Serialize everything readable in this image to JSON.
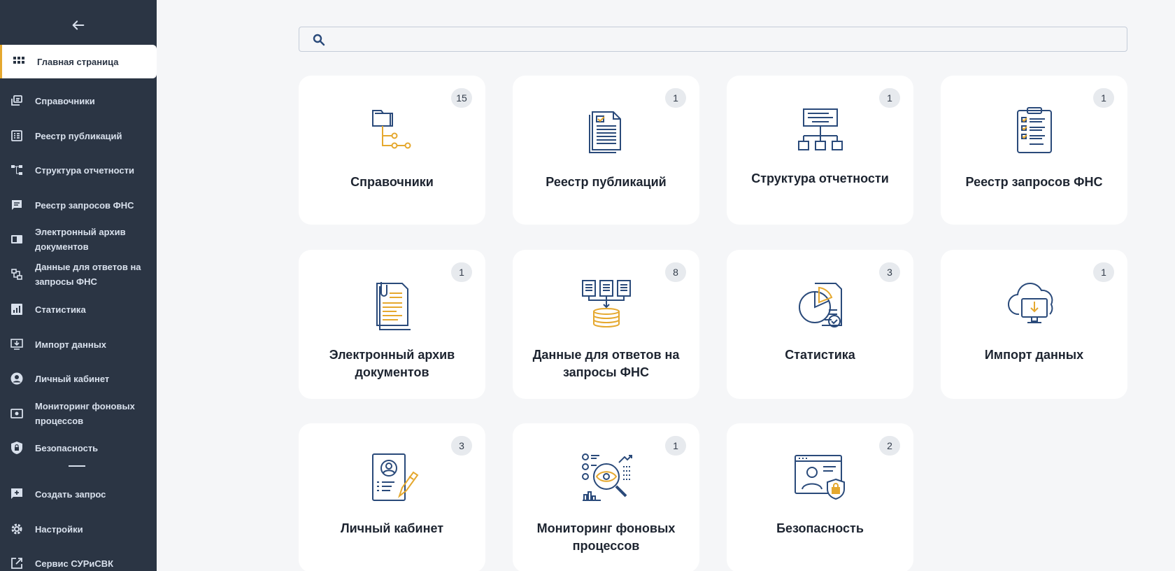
{
  "sidebar": {
    "active": {
      "label": "Главная страница",
      "icon": "grid-icon"
    },
    "items": [
      {
        "label": "Справочники",
        "icon": "copy-icon"
      },
      {
        "label": "Реестр публикаций",
        "icon": "list-icon"
      },
      {
        "label": "Структура отчетности",
        "icon": "hierarchy-icon"
      },
      {
        "label": "Реестр запросов ФНС",
        "icon": "chat-lines-icon"
      },
      {
        "label": "Электронный архив документов",
        "icon": "archive-icon"
      },
      {
        "label": "Данные для ответов на запросы ФНС",
        "icon": "data-flow-icon"
      },
      {
        "label": "Статистика",
        "icon": "bar-chart-icon"
      },
      {
        "label": "Импорт данных",
        "icon": "import-icon"
      },
      {
        "label": "Личный кабинет",
        "icon": "user-circle-icon"
      },
      {
        "label": "Мониторинг фоновых процессов",
        "icon": "monitor-icon"
      },
      {
        "label": "Безопасность",
        "icon": "shield-lock-icon"
      }
    ],
    "bottom_items": [
      {
        "label": "Создать запрос",
        "icon": "add-chat-icon"
      },
      {
        "label": "Настройки",
        "icon": "gear-icon"
      },
      {
        "label": "Сервис СУРиСВК",
        "icon": "external-link-icon"
      }
    ]
  },
  "search": {
    "value": "",
    "placeholder": ""
  },
  "cards": [
    {
      "title": "Справочники",
      "count": "15",
      "icon": "folder-tree-icon"
    },
    {
      "title": "Реестр публикаций",
      "count": "1",
      "icon": "document-icon"
    },
    {
      "title": "Структура отчетности",
      "count": "1",
      "icon": "org-chart-icon"
    },
    {
      "title": "Реестр запросов ФНС",
      "count": "1",
      "icon": "clipboard-checklist-icon"
    },
    {
      "title": "Электронный архив документов",
      "count": "1",
      "icon": "paper-archive-icon"
    },
    {
      "title": "Данные для ответов на запросы ФНС",
      "count": "8",
      "icon": "documents-database-icon"
    },
    {
      "title": "Статистика",
      "count": "3",
      "icon": "pie-report-icon"
    },
    {
      "title": "Импорт данных",
      "count": "1",
      "icon": "cloud-download-icon"
    },
    {
      "title": "Личный кабинет",
      "count": "3",
      "icon": "profile-edit-icon"
    },
    {
      "title": "Мониторинг фоновых процессов",
      "count": "1",
      "icon": "eye-analytics-icon"
    },
    {
      "title": "Безопасность",
      "count": "2",
      "icon": "secure-profile-icon"
    }
  ],
  "colors": {
    "sidebar": "#2b3544",
    "accent": "#e5a82e",
    "icon_blue": "#2a4a7a",
    "background": "#f5f6f8"
  }
}
